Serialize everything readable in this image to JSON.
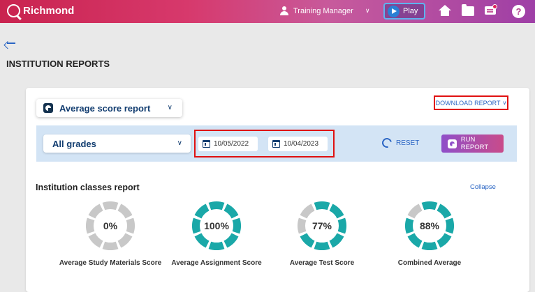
{
  "header": {
    "brand": "Richmond",
    "user": "Training Manager",
    "play_label": "Play"
  },
  "page": {
    "title": "INSTITUTION REPORTS"
  },
  "report": {
    "selected": "Average score report",
    "download_label": "DOWNLOAD REPORT"
  },
  "filters": {
    "grade": "All grades",
    "date_from": "10/05/2022",
    "date_to": "10/04/2023",
    "reset_label": "RESET",
    "run_label": "RUN REPORT"
  },
  "section": {
    "title": "Institution classes report",
    "collapse_label": "Collapse"
  },
  "colors": {
    "accent": "#1aa8a8",
    "track": "#c8c8c8",
    "link": "#2a65c4"
  },
  "metrics": [
    {
      "value": "0%",
      "percent": 0,
      "label": "Average Study Materials Score"
    },
    {
      "value": "100%",
      "percent": 100,
      "label": "Average Assignment Score"
    },
    {
      "value": "77%",
      "percent": 77,
      "label": "Average Test Score"
    },
    {
      "value": "88%",
      "percent": 88,
      "label": "Combined Average"
    }
  ]
}
